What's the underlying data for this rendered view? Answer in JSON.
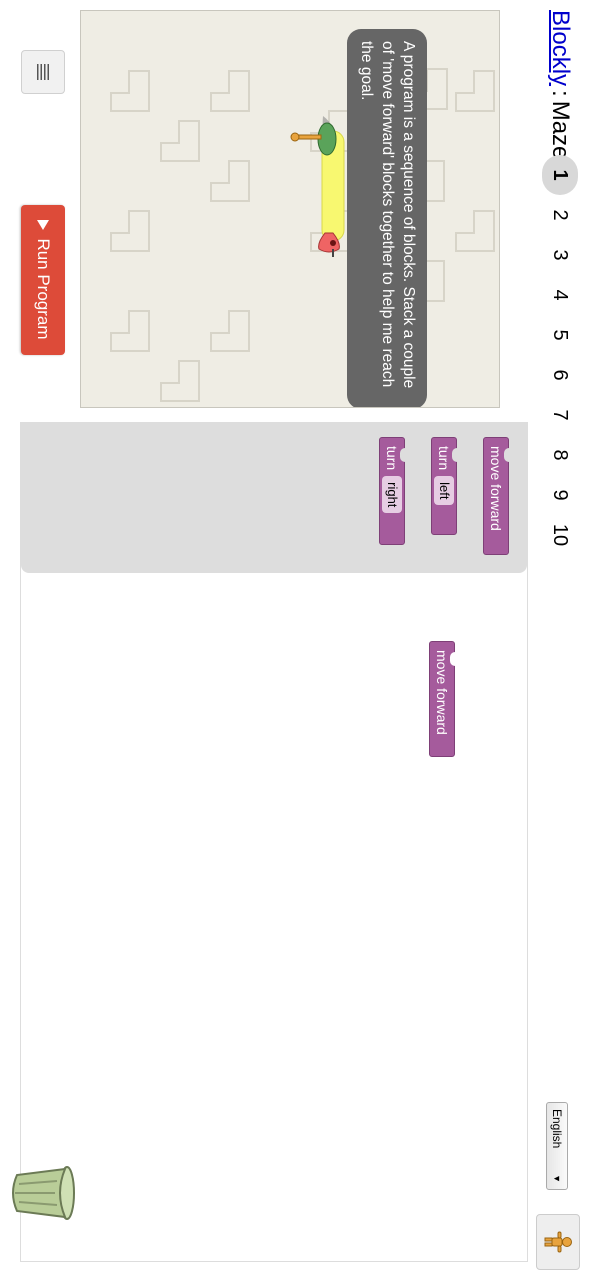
{
  "header": {
    "app_link": "Blockly",
    "separator": ":",
    "title": "Maze"
  },
  "levels": [
    "1",
    "2",
    "3",
    "4",
    "5",
    "6",
    "7",
    "8",
    "9",
    "10"
  ],
  "selected_level": "1",
  "language": {
    "selected": "English"
  },
  "maze": {
    "instruction": "A program is a sequence of blocks. Stack a couple of 'move forward' blocks together to help me reach the goal."
  },
  "controls": {
    "run_label": "Run Program"
  },
  "toolbox": {
    "move_forward": "move forward",
    "turn_left_prefix": "turn",
    "turn_left_value": "left",
    "turn_right_prefix": "turn",
    "turn_right_value": "right"
  },
  "workspace": {
    "block_label": "move forward"
  },
  "colors": {
    "block": "#a55b9c",
    "run_button": "#dd4b39",
    "maze_background": "#efede4",
    "path": "#f8f870",
    "toolbox_background": "#dddddd"
  },
  "icons": [
    "menu-icon",
    "help-person-icon",
    "trash-icon",
    "pegman-icon",
    "goal-marker-icon"
  ]
}
